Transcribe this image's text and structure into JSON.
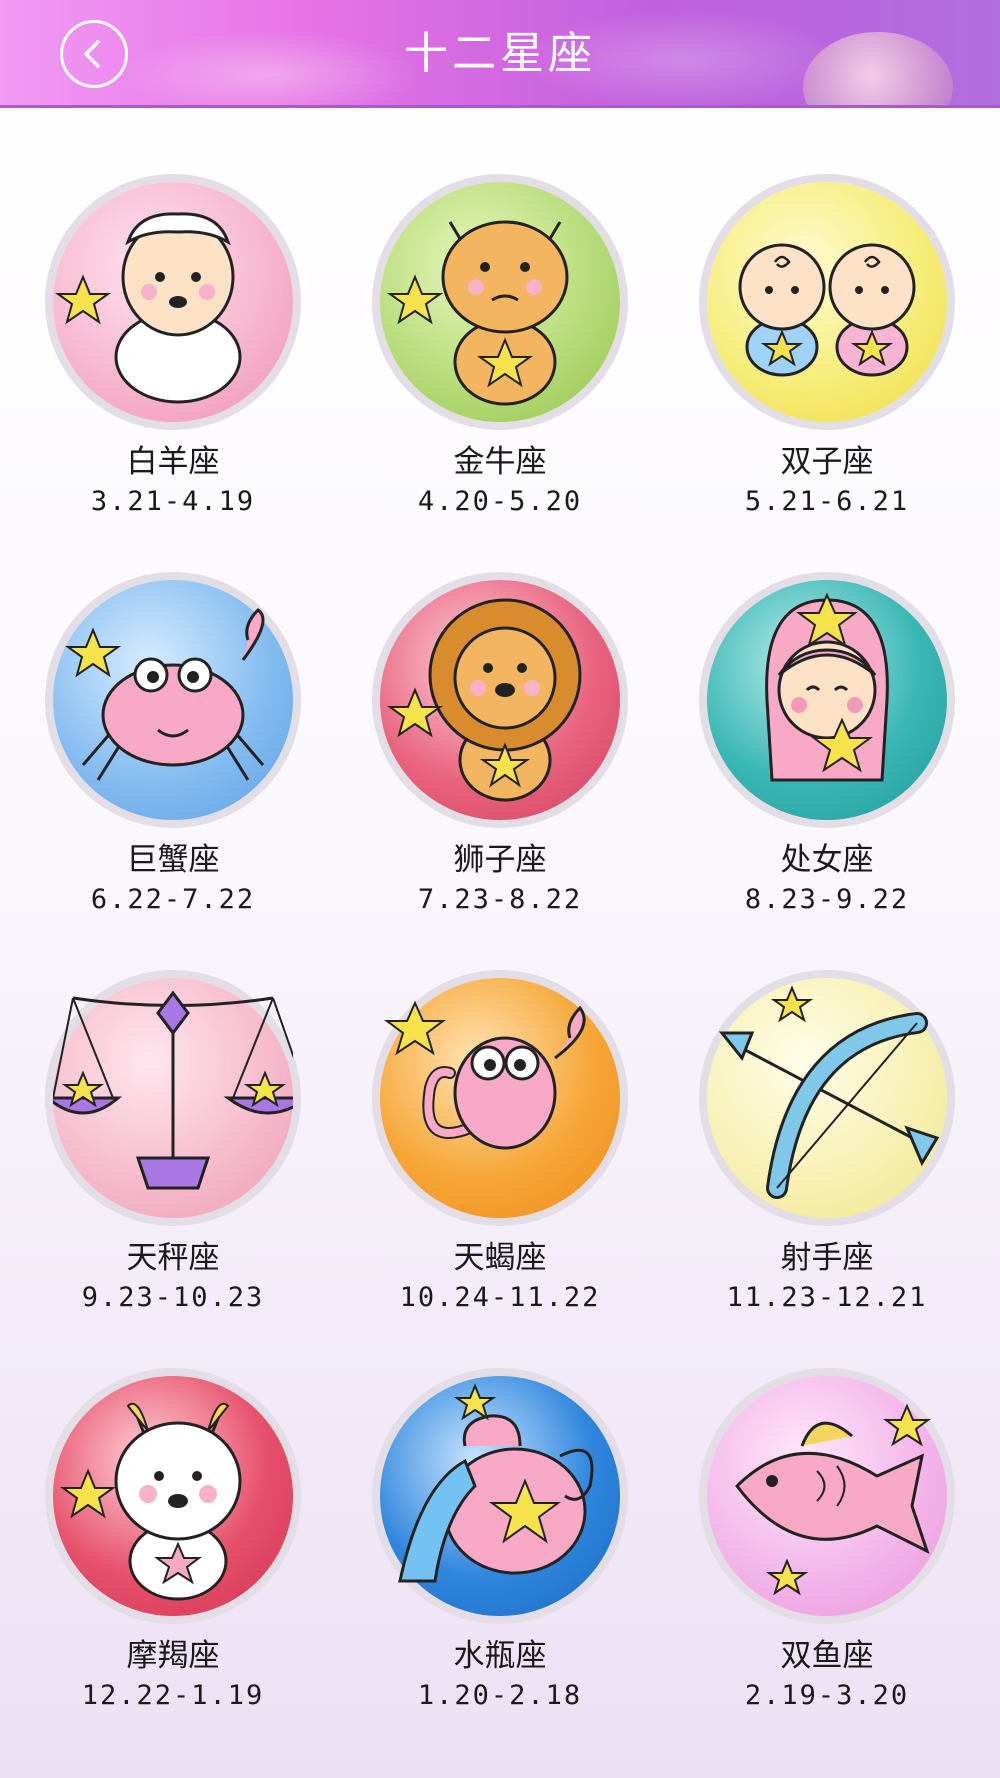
{
  "header": {
    "title": "十二星座",
    "back_icon": "back-arrow-icon"
  },
  "signs": [
    {
      "id": "aries",
      "name": "白羊座",
      "date": "3.21-4.19",
      "color": "#f7b7cf",
      "icon": "ram-icon"
    },
    {
      "id": "taurus",
      "name": "金牛座",
      "date": "4.20-5.20",
      "color": "#b7dc7a",
      "icon": "bull-icon"
    },
    {
      "id": "gemini",
      "name": "双子座",
      "date": "5.21-6.21",
      "color": "#f6ed7a",
      "icon": "twins-icon"
    },
    {
      "id": "cancer",
      "name": "巨蟹座",
      "date": "6.22-7.22",
      "color": "#86bdf0",
      "icon": "crab-icon"
    },
    {
      "id": "leo",
      "name": "狮子座",
      "date": "7.23-8.22",
      "color": "#e9647f",
      "icon": "lion-icon"
    },
    {
      "id": "virgo",
      "name": "处女座",
      "date": "8.23-9.22",
      "color": "#3ab7b5",
      "icon": "maiden-icon"
    },
    {
      "id": "libra",
      "name": "天秤座",
      "date": "9.23-10.23",
      "color": "#f6bccd",
      "icon": "scales-icon"
    },
    {
      "id": "scorpio",
      "name": "天蝎座",
      "date": "10.24-11.22",
      "color": "#f6a637",
      "icon": "scorpion-icon"
    },
    {
      "id": "sagittarius",
      "name": "射手座",
      "date": "11.23-12.21",
      "color": "#f8f1b4",
      "icon": "bow-arrow-icon"
    },
    {
      "id": "capricorn",
      "name": "摩羯座",
      "date": "12.22-1.19",
      "color": "#e7506a",
      "icon": "goat-icon"
    },
    {
      "id": "aquarius",
      "name": "水瓶座",
      "date": "1.20-2.18",
      "color": "#2f86dd",
      "icon": "water-jar-icon"
    },
    {
      "id": "pisces",
      "name": "双鱼座",
      "date": "2.19-3.20",
      "color": "#f3b6ea",
      "icon": "fish-icon"
    }
  ]
}
